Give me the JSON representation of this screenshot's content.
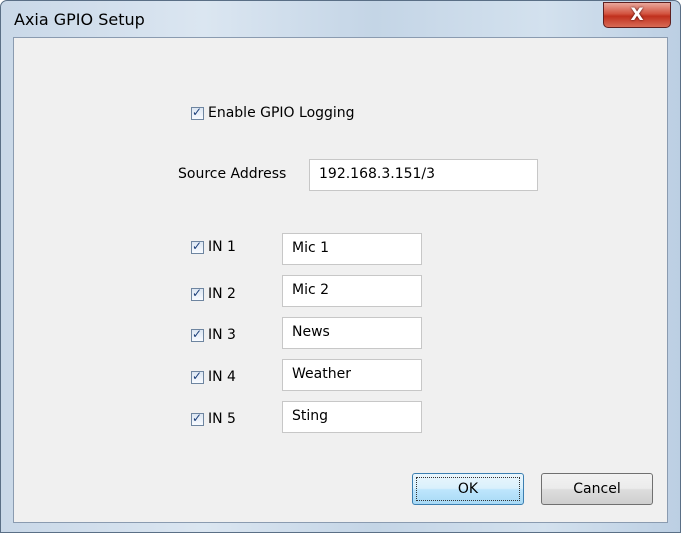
{
  "window": {
    "title": "Axia GPIO Setup"
  },
  "title_bar": {
    "close_glyph": "X"
  },
  "enable_logging": {
    "label": "Enable GPIO Logging",
    "checked": true
  },
  "source": {
    "label": "Source Address",
    "value": "192.168.3.151/3"
  },
  "inputs": [
    {
      "label": "IN 1",
      "checked": true,
      "name": "Mic 1"
    },
    {
      "label": "IN 2",
      "checked": true,
      "name": "Mic 2"
    },
    {
      "label": "IN 3",
      "checked": true,
      "name": "News"
    },
    {
      "label": "IN 4",
      "checked": true,
      "name": "Weather"
    },
    {
      "label": "IN 5",
      "checked": true,
      "name": "Sting"
    }
  ],
  "buttons": {
    "ok": "OK",
    "cancel": "Cancel"
  },
  "colors": {
    "close_button": "#c8432e",
    "default_button_border": "#3c7fb1"
  }
}
